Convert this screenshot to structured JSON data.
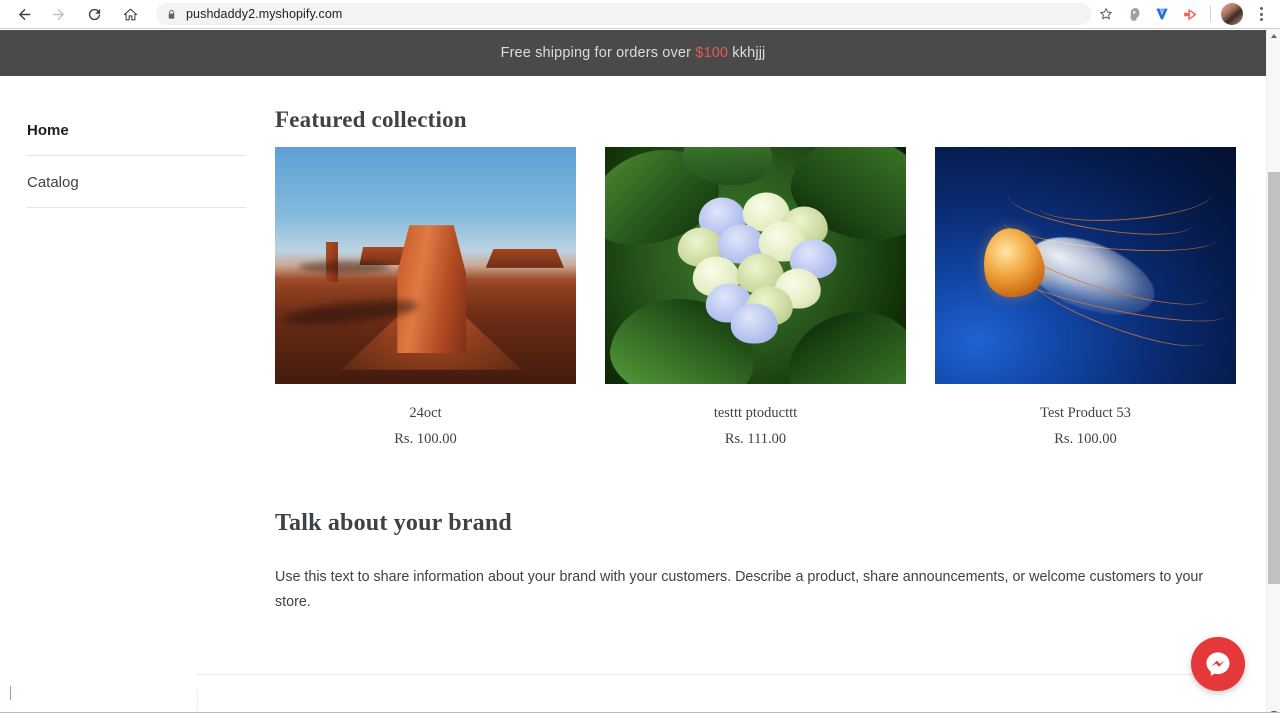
{
  "browser": {
    "url": "pushdaddy2.myshopify.com",
    "back_icon": "back-arrow-icon",
    "forward_icon": "forward-arrow-icon",
    "reload_icon": "reload-icon",
    "home_icon": "home-icon",
    "lock_icon": "lock-icon",
    "bookmark_icon": "star-icon",
    "extension_icons": [
      "head-profile-icon",
      "blue-v-icon",
      "red-play-icon"
    ],
    "avatar": "user-avatar",
    "menu_icon": "three-dot-menu-icon"
  },
  "announcement": {
    "prefix": "Free shipping for orders over ",
    "highlight": "$100",
    "suffix": " kkhjjj",
    "background_color": "#4a4a4a",
    "highlight_color": "#e05a52"
  },
  "sidebar": {
    "items": [
      {
        "label": "Home",
        "active": true
      },
      {
        "label": "Catalog",
        "active": false
      }
    ]
  },
  "main": {
    "featured_heading": "Featured collection",
    "products": [
      {
        "title": "24oct",
        "price": "Rs. 100.00",
        "image": "desert-butte-photo"
      },
      {
        "title": "testtt ptoducttt",
        "price": "Rs. 111.00",
        "image": "hydrangea-flower-photo"
      },
      {
        "title": "Test Product 53",
        "price": "Rs. 100.00",
        "image": "jellyfish-photo"
      }
    ],
    "brand_heading": "Talk about your brand",
    "brand_body": "Use this text to share information about your brand with your customers. Describe a product, share announcements, or welcome customers to your store."
  },
  "chat": {
    "widget": "facebook-messenger-button",
    "color": "#e4383a"
  },
  "scrollbar": {
    "up_icon": "scroll-up-arrow-icon",
    "down_icon": "scroll-down-arrow-icon"
  }
}
